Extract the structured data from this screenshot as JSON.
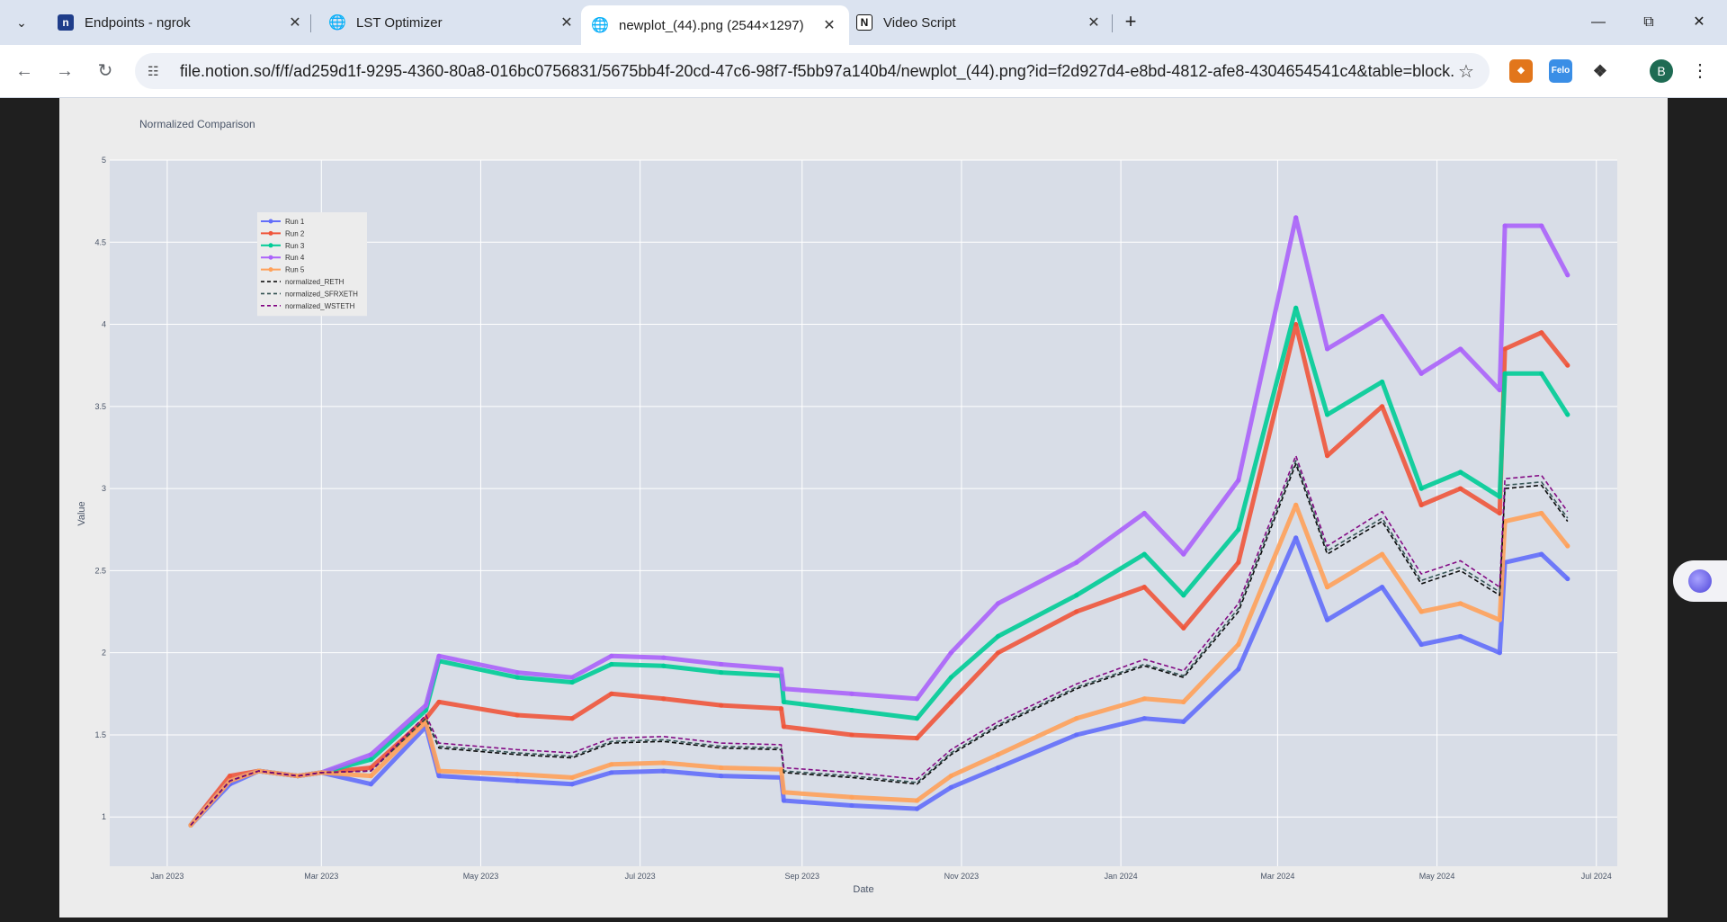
{
  "browser": {
    "tabs": [
      {
        "title": "Endpoints - ngrok",
        "icon": "notion-n-icon",
        "active": false
      },
      {
        "title": "LST Optimizer",
        "icon": "globe-icon",
        "active": false
      },
      {
        "title": "newplot_(44).png (2544×1297)",
        "icon": "globe-icon",
        "active": true
      },
      {
        "title": "Video Script",
        "icon": "notion-icon",
        "active": false
      }
    ],
    "url": "file.notion.so/f/f/ad259d1f-9295-4360-80a8-016bc0756831/5675bb4f-20cd-47c6-98f7-f5bb97a140b4/newplot_(44).png?id=f2d927d4-e8bd-4812-afe8-4304654541c4&table=block...",
    "profile_initial": "B",
    "extensions": [
      {
        "name": "metamask-fox-icon",
        "color": "#e2761b"
      },
      {
        "name": "felo-icon",
        "color": "#3a8ee6",
        "label": "Felo"
      },
      {
        "name": "puzzle-extensions-icon",
        "color": "#5f6368"
      }
    ]
  },
  "chart_data": {
    "type": "line",
    "title": "Normalized Comparison",
    "xlabel": "Date",
    "ylabel": "Value",
    "ylim": [
      0.7,
      5.0
    ],
    "y_ticks": [
      1,
      1.5,
      2,
      2.5,
      3,
      3.5,
      4,
      4.5,
      5
    ],
    "y_tick_labels": [
      "1",
      "1.5",
      "2",
      "2.5",
      "3",
      "3.5",
      "4",
      "4.5",
      "5"
    ],
    "xlim": [
      "2022-12-10",
      "2024-07-09"
    ],
    "x_ticks": [
      "2023-01-01",
      "2023-03-01",
      "2023-05-01",
      "2023-07-01",
      "2023-09-01",
      "2023-11-01",
      "2024-01-01",
      "2024-03-01",
      "2024-05-01",
      "2024-07-01"
    ],
    "x_tick_labels": [
      "Jan 2023",
      "Mar 2023",
      "May 2023",
      "Jul 2023",
      "Sep 2023",
      "Nov 2023",
      "Jan 2024",
      "Mar 2024",
      "May 2024",
      "Jul 2024"
    ],
    "grid": true,
    "legend_position": "top-left",
    "x": [
      "2023-01-10",
      "2023-01-25",
      "2023-02-05",
      "2023-02-20",
      "2023-03-01",
      "2023-03-20",
      "2023-04-10",
      "2023-04-15",
      "2023-05-15",
      "2023-06-05",
      "2023-06-20",
      "2023-07-10",
      "2023-08-01",
      "2023-08-24",
      "2023-08-25",
      "2023-09-20",
      "2023-10-15",
      "2023-10-28",
      "2023-11-15",
      "2023-12-15",
      "2024-01-10",
      "2024-01-25",
      "2024-02-15",
      "2024-03-08",
      "2024-03-20",
      "2024-04-10",
      "2024-04-25",
      "2024-05-10",
      "2024-05-25",
      "2024-05-27",
      "2024-06-10",
      "2024-06-20"
    ],
    "series": [
      {
        "name": "Run 1",
        "color": "#636efa",
        "style": "line-markers",
        "values": [
          0.95,
          1.2,
          1.28,
          1.25,
          1.27,
          1.2,
          1.55,
          1.25,
          1.22,
          1.2,
          1.27,
          1.28,
          1.25,
          1.24,
          1.1,
          1.07,
          1.05,
          1.18,
          1.3,
          1.5,
          1.6,
          1.58,
          1.9,
          2.7,
          2.2,
          2.4,
          2.05,
          2.1,
          2.0,
          2.55,
          2.6,
          2.45
        ]
      },
      {
        "name": "Run 2",
        "color": "#ef553b",
        "style": "line-markers",
        "values": [
          0.95,
          1.25,
          1.28,
          1.25,
          1.27,
          1.3,
          1.6,
          1.7,
          1.62,
          1.6,
          1.75,
          1.72,
          1.68,
          1.66,
          1.55,
          1.5,
          1.48,
          1.7,
          2.0,
          2.25,
          2.4,
          2.15,
          2.55,
          4.0,
          3.2,
          3.5,
          2.9,
          3.0,
          2.85,
          3.85,
          3.95,
          3.75
        ]
      },
      {
        "name": "Run 3",
        "color": "#00cc96",
        "style": "line-markers",
        "values": [
          0.95,
          1.22,
          1.28,
          1.25,
          1.27,
          1.35,
          1.65,
          1.95,
          1.85,
          1.82,
          1.93,
          1.92,
          1.88,
          1.86,
          1.7,
          1.65,
          1.6,
          1.85,
          2.1,
          2.35,
          2.6,
          2.35,
          2.75,
          4.1,
          3.45,
          3.65,
          3.0,
          3.1,
          2.95,
          3.7,
          3.7,
          3.45
        ]
      },
      {
        "name": "Run 4",
        "color": "#ab63fa",
        "style": "line-markers",
        "values": [
          0.95,
          1.22,
          1.28,
          1.25,
          1.27,
          1.38,
          1.68,
          1.98,
          1.88,
          1.85,
          1.98,
          1.97,
          1.93,
          1.9,
          1.78,
          1.75,
          1.72,
          2.0,
          2.3,
          2.55,
          2.85,
          2.6,
          3.05,
          4.65,
          3.85,
          4.05,
          3.7,
          3.85,
          3.6,
          4.6,
          4.6,
          4.3
        ]
      },
      {
        "name": "Run 5",
        "color": "#ffa15a",
        "style": "line-markers",
        "values": [
          0.95,
          1.22,
          1.28,
          1.25,
          1.27,
          1.25,
          1.58,
          1.28,
          1.26,
          1.24,
          1.32,
          1.33,
          1.3,
          1.29,
          1.15,
          1.12,
          1.1,
          1.25,
          1.38,
          1.6,
          1.72,
          1.7,
          2.05,
          2.9,
          2.4,
          2.6,
          2.25,
          2.3,
          2.2,
          2.8,
          2.85,
          2.65
        ]
      },
      {
        "name": "normalized_RETH",
        "color": "#000000",
        "style": "dash",
        "values": [
          0.95,
          1.22,
          1.28,
          1.25,
          1.27,
          1.28,
          1.6,
          1.42,
          1.38,
          1.36,
          1.45,
          1.46,
          1.42,
          1.41,
          1.27,
          1.24,
          1.2,
          1.38,
          1.55,
          1.78,
          1.92,
          1.85,
          2.25,
          3.15,
          2.6,
          2.8,
          2.42,
          2.5,
          2.35,
          3.0,
          3.02,
          2.8
        ]
      },
      {
        "name": "normalized_SFRXETH",
        "color": "#2f4f4f",
        "style": "dash",
        "values": [
          0.95,
          1.22,
          1.28,
          1.25,
          1.27,
          1.28,
          1.6,
          1.43,
          1.39,
          1.37,
          1.46,
          1.47,
          1.43,
          1.42,
          1.28,
          1.25,
          1.21,
          1.39,
          1.56,
          1.79,
          1.93,
          1.86,
          2.27,
          3.17,
          2.62,
          2.82,
          2.44,
          2.52,
          2.37,
          3.02,
          3.04,
          2.82
        ]
      },
      {
        "name": "normalized_WSTETH",
        "color": "#800080",
        "style": "dash",
        "values": [
          0.95,
          1.22,
          1.28,
          1.25,
          1.27,
          1.28,
          1.62,
          1.45,
          1.41,
          1.39,
          1.48,
          1.49,
          1.45,
          1.44,
          1.3,
          1.27,
          1.23,
          1.41,
          1.58,
          1.81,
          1.96,
          1.89,
          2.3,
          3.2,
          2.65,
          2.86,
          2.48,
          2.56,
          2.4,
          3.06,
          3.08,
          2.86
        ]
      }
    ]
  }
}
